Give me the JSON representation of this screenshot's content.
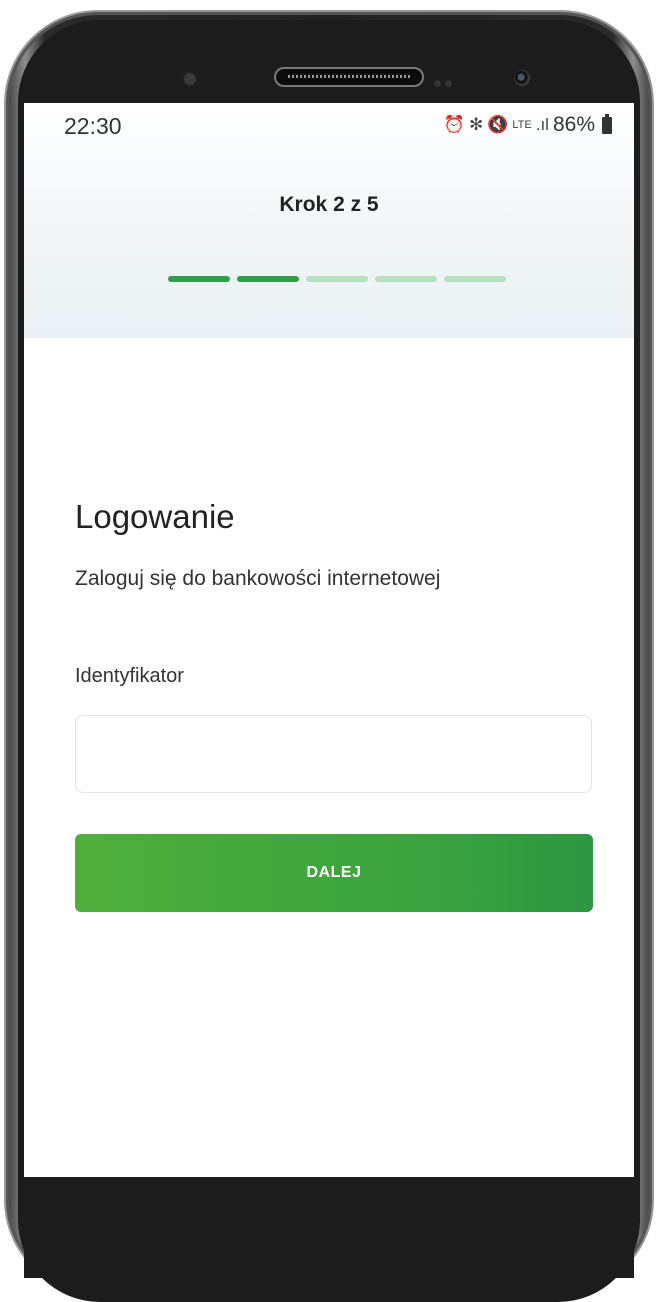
{
  "status_bar": {
    "time": "22:30",
    "icons": [
      "alarm-icon",
      "bluetooth-icon",
      "mute-icon",
      "lte-icon",
      "signal-icon"
    ],
    "lte_label": "LTE",
    "signal_label": ".ıl",
    "battery_percent": "86%"
  },
  "wizard": {
    "step_label": "Krok 2 z 5",
    "current_step": 2,
    "total_steps": 5,
    "colors": {
      "done": "#2e9e4b",
      "todo": "#b7e0c0"
    }
  },
  "login": {
    "title": "Logowanie",
    "subtitle": "Zaloguj się do bankowości internetowej",
    "identifier_label": "Identyfikator",
    "identifier_value": "",
    "identifier_placeholder": "",
    "next_button": "DALEJ"
  },
  "colors": {
    "accent": "#3aa23f"
  }
}
